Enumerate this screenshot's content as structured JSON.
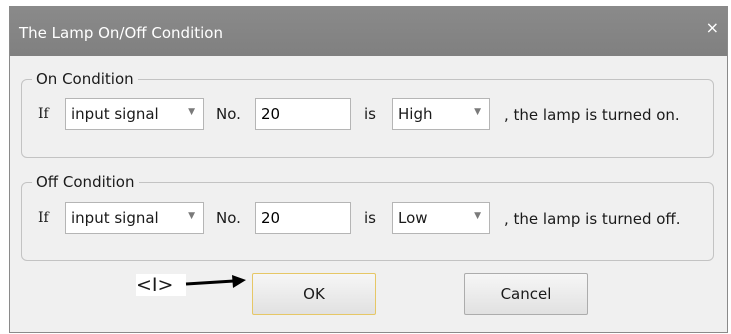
{
  "dialog": {
    "title": "The Lamp On/Off Condition",
    "close_glyph": "×"
  },
  "on_condition": {
    "legend": "On Condition",
    "if_label": "If",
    "source": "input signal",
    "no_label": "No.",
    "number": "20",
    "is_label": "is",
    "state": "High",
    "suffix": ", the lamp is turned on."
  },
  "off_condition": {
    "legend": "Off Condition",
    "if_label": "If",
    "source": "input signal",
    "no_label": "No.",
    "number": "20",
    "is_label": "is",
    "state": "Low",
    "suffix": ", the lamp is turned off."
  },
  "buttons": {
    "ok": "OK",
    "cancel": "Cancel"
  },
  "annotation": {
    "marker": "<I>"
  },
  "icons": {
    "dropdown": "chevron-down-icon",
    "close": "close-icon",
    "pointer": "arrow-right-icon"
  },
  "colors": {
    "titlebar": "#858585",
    "default_button_border": "#e6c766"
  }
}
